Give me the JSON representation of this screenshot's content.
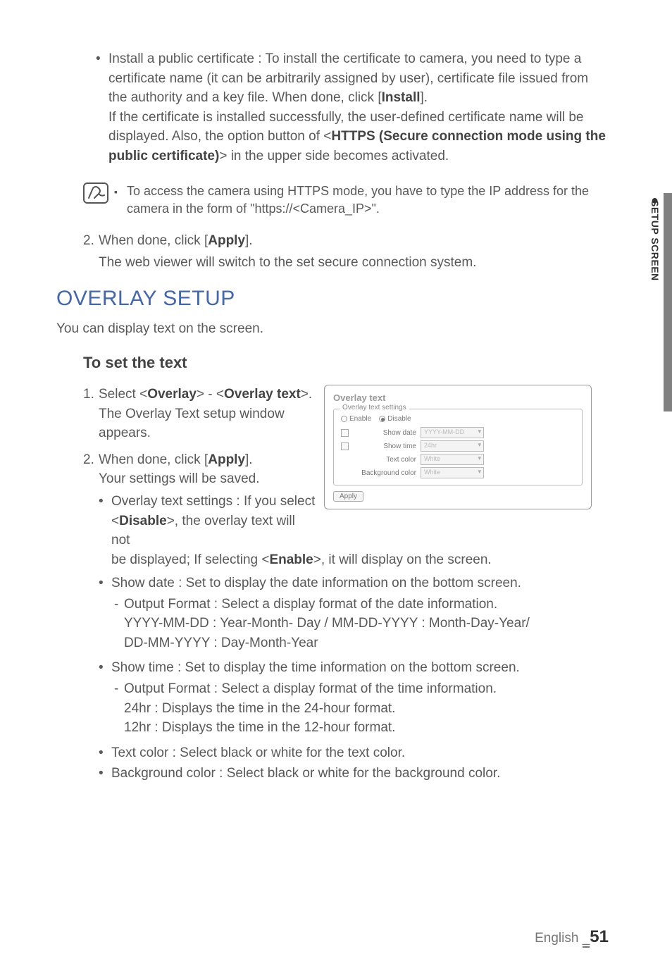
{
  "sidetab": {
    "label": "SETUP SCREEN"
  },
  "top_bullet": {
    "l1": "Install a public certificate : To install the certificate to camera, you need to type a certificate name (it can be arbitrarily assigned by user), certificate file issued from the authority and a key file. When done, click [",
    "l1b": "Install",
    "l1c": "].",
    "l2a": "If the certificate is installed successfully, the user-defined certificate name will be displayed. Also, the option button of <",
    "l2b": "HTTPS (Secure connection mode using the public certificate)",
    "l2c": "> in the upper side becomes activated."
  },
  "note": {
    "text": "To access the camera using HTTPS mode, you have to type the IP address for the camera in the form of \"https://<Camera_IP>\"."
  },
  "step2a": {
    "num": "2.",
    "a": "When done, click [",
    "b": "Apply",
    "c": "]."
  },
  "step2a_sub": "The web viewer will switch to the set secure connection system.",
  "h1": "OVERLAY SETUP",
  "intro": "You can display text on the screen.",
  "h2": "To set the text",
  "ol": {
    "s1": {
      "num": "1.",
      "a": "Select <",
      "b": "Overlay",
      "c": "> - <",
      "d": "Overlay text",
      "e": ">.",
      "sub": "The Overlay Text setup window appears."
    },
    "s2": {
      "num": "2.",
      "a": "When done, click [",
      "b": "Apply",
      "c": "].",
      "sub": "Your settings will be saved."
    }
  },
  "screenshot": {
    "title": "Overlay text",
    "legend": "Overlay text settings",
    "radio_enable": "Enable",
    "radio_disable": "Disable",
    "rows": {
      "show_date": {
        "label": "Show date",
        "value": "YYYY-MM-DD"
      },
      "show_time": {
        "label": "Show time",
        "value": "24hr"
      },
      "text_color": {
        "label": "Text color",
        "value": "White"
      },
      "bg_color": {
        "label": "Background color",
        "value": "White"
      }
    },
    "apply": "Apply"
  },
  "sub_bullets": {
    "b1": {
      "a": "Overlay text settings : If you select <",
      "b": "Disable",
      "c": ">, the overlay text will not be displayed; If selecting <",
      "d": "Enable",
      "e": ">, it will display on the screen."
    },
    "b2": "Show date : Set to display the date information on the bottom screen.",
    "b2d": {
      "a": "Output Format : Select a display format of the date information.",
      "b": "YYYY-MM-DD : Year-Month- Day / MM-DD-YYYY : Month-Day-Year/",
      "c": "DD-MM-YYYY : Day-Month-Year"
    },
    "b3": "Show time : Set to display the time information on the bottom screen.",
    "b3d": {
      "a": "Output Format : Select a display format of the time information.",
      "b": "24hr : Displays the time in the 24-hour format.",
      "c": "12hr : Displays the time in the 12-hour format."
    },
    "b4": "Text color : Select black or white for the text color.",
    "b5": "Background color : Select black or white for the background color."
  },
  "footer": {
    "lang": "English",
    "sep": "_",
    "page": "51"
  }
}
